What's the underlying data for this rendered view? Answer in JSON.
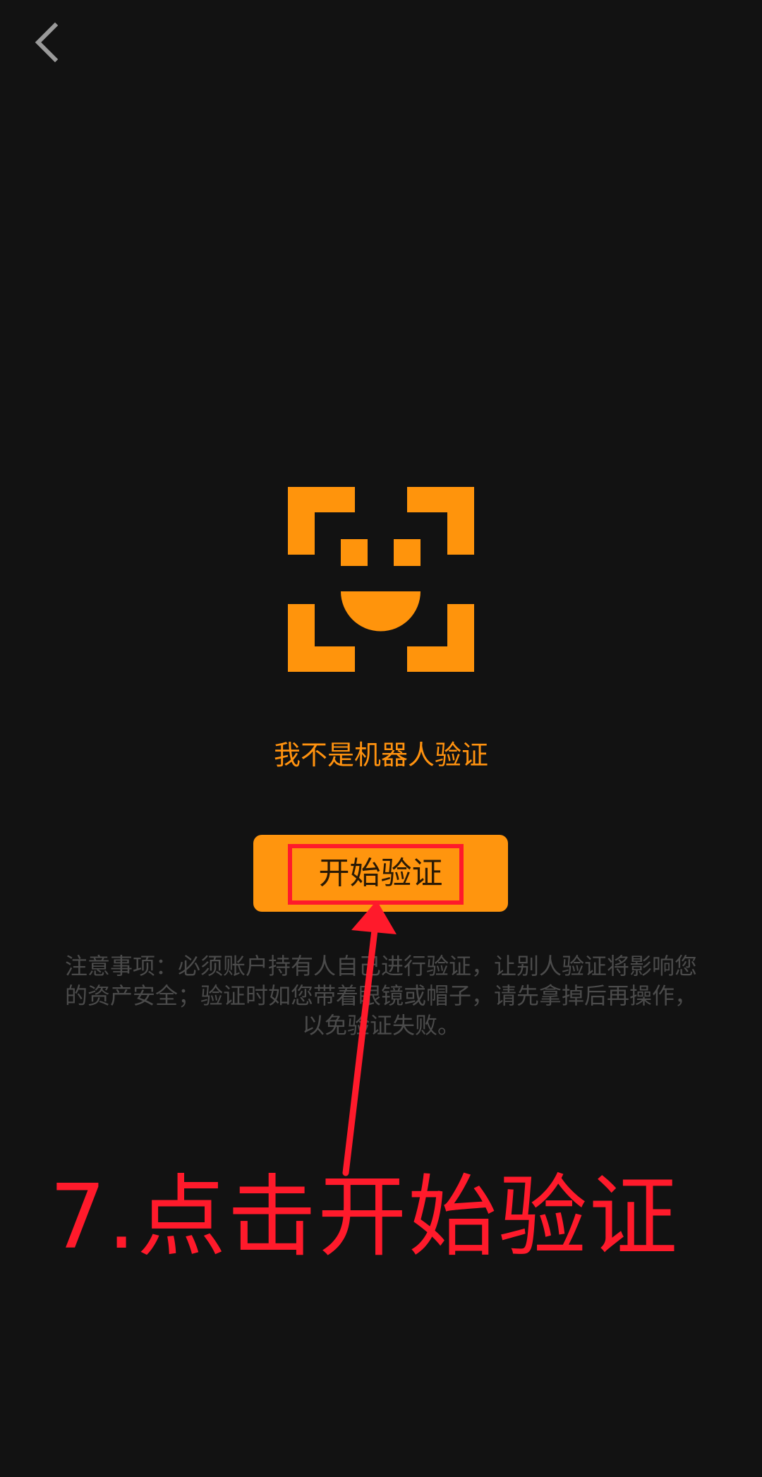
{
  "header": {
    "back_icon": "chevron-left-icon"
  },
  "verification": {
    "icon": "face-scan-icon",
    "title": "我不是机器人验证",
    "start_button_label": "开始验证",
    "notice": "注意事项：必须账户持有人自己进行验证，让别人验证将影响您的资产安全；验证时如您带着眼镜或帽子，请先拿掉后再操作，以免验证失败。"
  },
  "annotation": {
    "step_caption": "7.点击开始验证"
  },
  "colors": {
    "background": "#121212",
    "accent": "#ff950e",
    "annotation_red": "#ff1a2b",
    "notice_text": "#4b4b4b",
    "back_icon": "#9a9a9a"
  }
}
